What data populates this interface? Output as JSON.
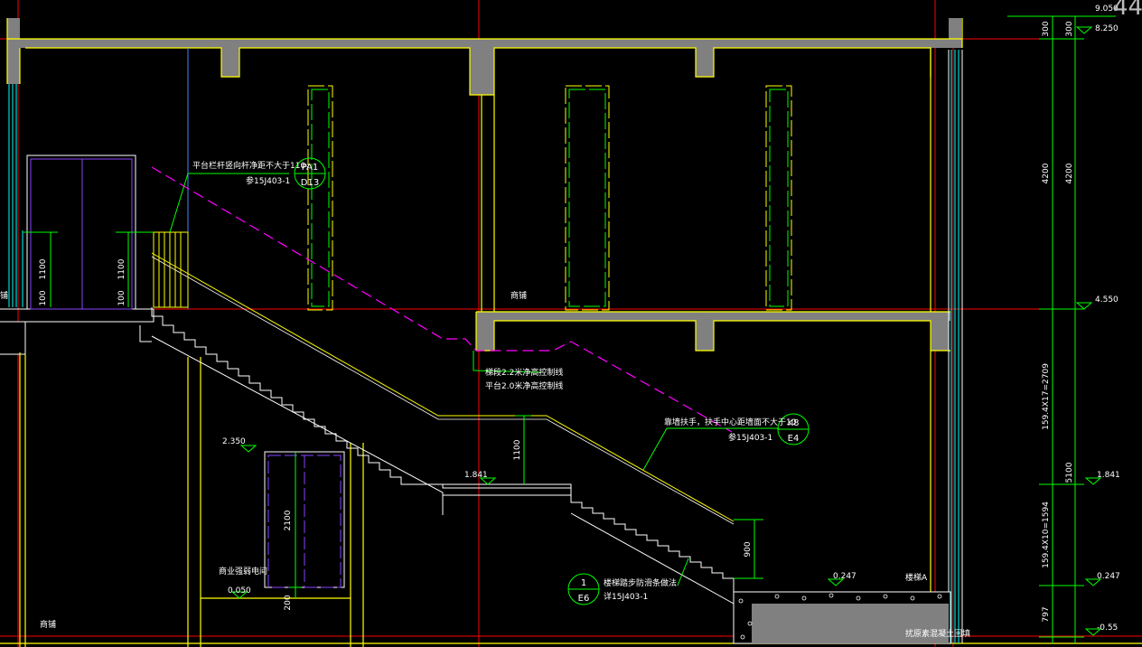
{
  "labels": {
    "platform_note": "平台栏杆竖向杆净距不大于110，",
    "platform_ref": "参15J403-1",
    "bubble_pa1_top": "PA1",
    "bubble_pa1_bottom": "D13",
    "clearance_note_1": "梯段2.2米净高控制线",
    "clearance_note_2": "平台2.0米净高控制线",
    "handrail_note": "靠墙扶手，扶手中心距墙面不大于10",
    "handrail_ref": "参15J403-1",
    "bubble_k8_top": "K8",
    "bubble_k8_bottom": "E4",
    "nosing_note": "楼梯踏步防滑条做法",
    "nosing_ref": "详15J403-1",
    "bubble_1_top": "1",
    "bubble_1_bottom": "E6",
    "shop_upper": "商铺",
    "shop_lower": "商铺",
    "weak_room": "商业强弱电间",
    "stair_a": "楼梯A",
    "pile_note": "扰原素混凝土回填",
    "left_clip": "铺"
  },
  "dimensions": {
    "rail_1100_left": "1100",
    "rail_100_left": "100",
    "rail_1100_mid": "1100",
    "rail_100_mid": "100",
    "rail_1100_stair": "1100",
    "rail_900": "900",
    "door_2100": "2100",
    "door_200": "200",
    "right_300_a": "300",
    "right_300_b": "300",
    "right_4200_a": "4200",
    "right_4200_b": "4200",
    "right_flight_upper": "159.4X17=2709",
    "right_5100": "5100",
    "right_flight_lower": "159.4X10=1594",
    "right_797": "797"
  },
  "levels": {
    "top_a": "9.050",
    "top_b": "8.250",
    "floor2": "4.550",
    "landing": "1.841",
    "landing_inline": "1.841",
    "ground_mid": "0.247",
    "ground_right": "0.247",
    "room_floor": "0.050",
    "under_stair": "2.350",
    "bottom": "-0.55"
  },
  "corner_badge": "44",
  "colors": {
    "background": "#000000",
    "wall": "#ffff00",
    "slab_fill": "#808080",
    "axis": "#ff0000",
    "dimension": "#00ff00",
    "clearance": "#ff00ff",
    "window": "#00ffff",
    "glass": "#0000ff",
    "text": "#ffffff"
  }
}
